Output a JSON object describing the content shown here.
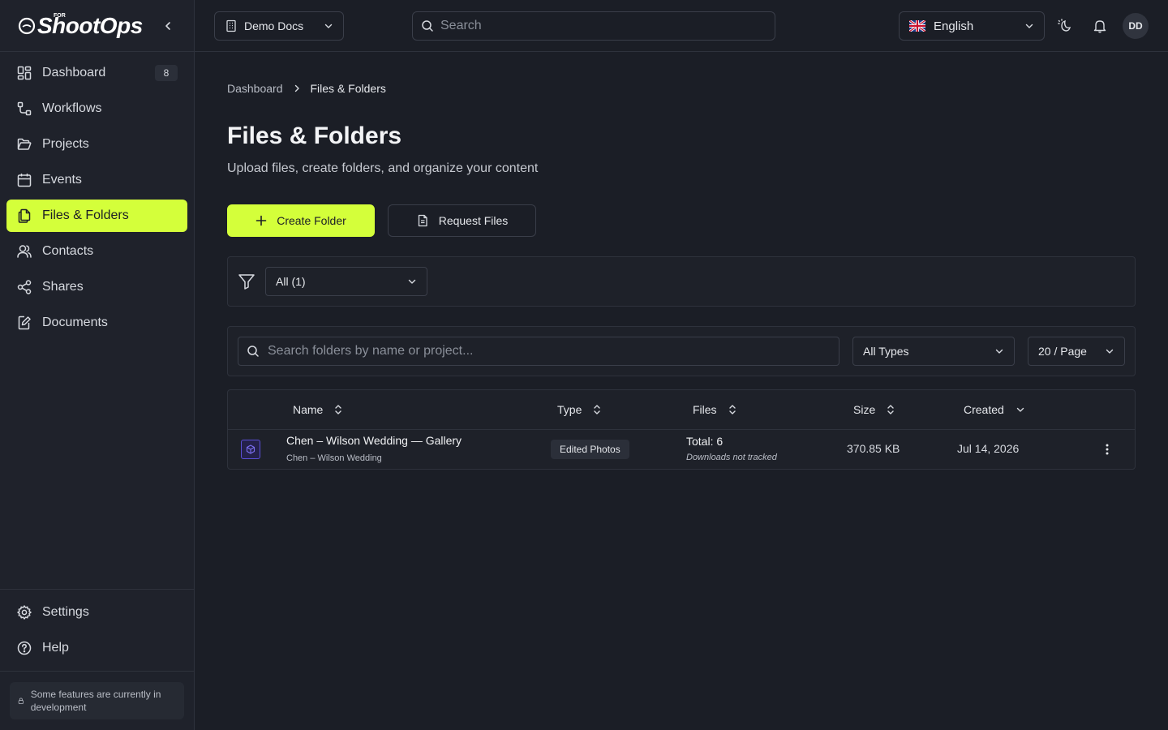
{
  "app": {
    "logo_text": "ShootOps",
    "logo_for": "FOR"
  },
  "sidebar": {
    "items": [
      {
        "label": "Dashboard",
        "icon": "dashboard-icon",
        "badge": "8"
      },
      {
        "label": "Workflows",
        "icon": "workflow-icon"
      },
      {
        "label": "Projects",
        "icon": "folder-open-icon"
      },
      {
        "label": "Events",
        "icon": "calendar-icon"
      },
      {
        "label": "Files & Folders",
        "icon": "files-icon",
        "active": true
      },
      {
        "label": "Contacts",
        "icon": "users-icon"
      },
      {
        "label": "Shares",
        "icon": "share-icon"
      },
      {
        "label": "Documents",
        "icon": "document-edit-icon"
      }
    ],
    "bottom_items": [
      {
        "label": "Settings",
        "icon": "gear-icon"
      },
      {
        "label": "Help",
        "icon": "help-icon"
      }
    ],
    "dev_note": "Some features are currently in development"
  },
  "topbar": {
    "workspace": "Demo Docs",
    "search_placeholder": "Search",
    "language": "English",
    "avatar_initials": "DD"
  },
  "breadcrumb": {
    "home": "Dashboard",
    "current": "Files & Folders"
  },
  "page": {
    "title": "Files & Folders",
    "subtitle": "Upload files, create folders, and organize your content"
  },
  "actions": {
    "create_folder": "Create Folder",
    "request_files": "Request Files"
  },
  "filter": {
    "selected": "All (1)"
  },
  "search": {
    "placeholder": "Search folders by name or project...",
    "type_filter": "All Types",
    "page_size": "20 / Page"
  },
  "table": {
    "columns": [
      "Name",
      "Type",
      "Files",
      "Size",
      "Created"
    ],
    "rows": [
      {
        "name": "Chen – Wilson Wedding — Gallery",
        "project": "Chen – Wilson Wedding",
        "type": "Edited Photos",
        "files_total": "Total: 6",
        "files_note": "Downloads not tracked",
        "size": "370.85 KB",
        "created": "Jul 14, 2026"
      }
    ]
  },
  "colors": {
    "accent": "#d4ff3a",
    "background": "#1b1e26",
    "sidebar": "#1f222b",
    "border": "#2e323c"
  }
}
